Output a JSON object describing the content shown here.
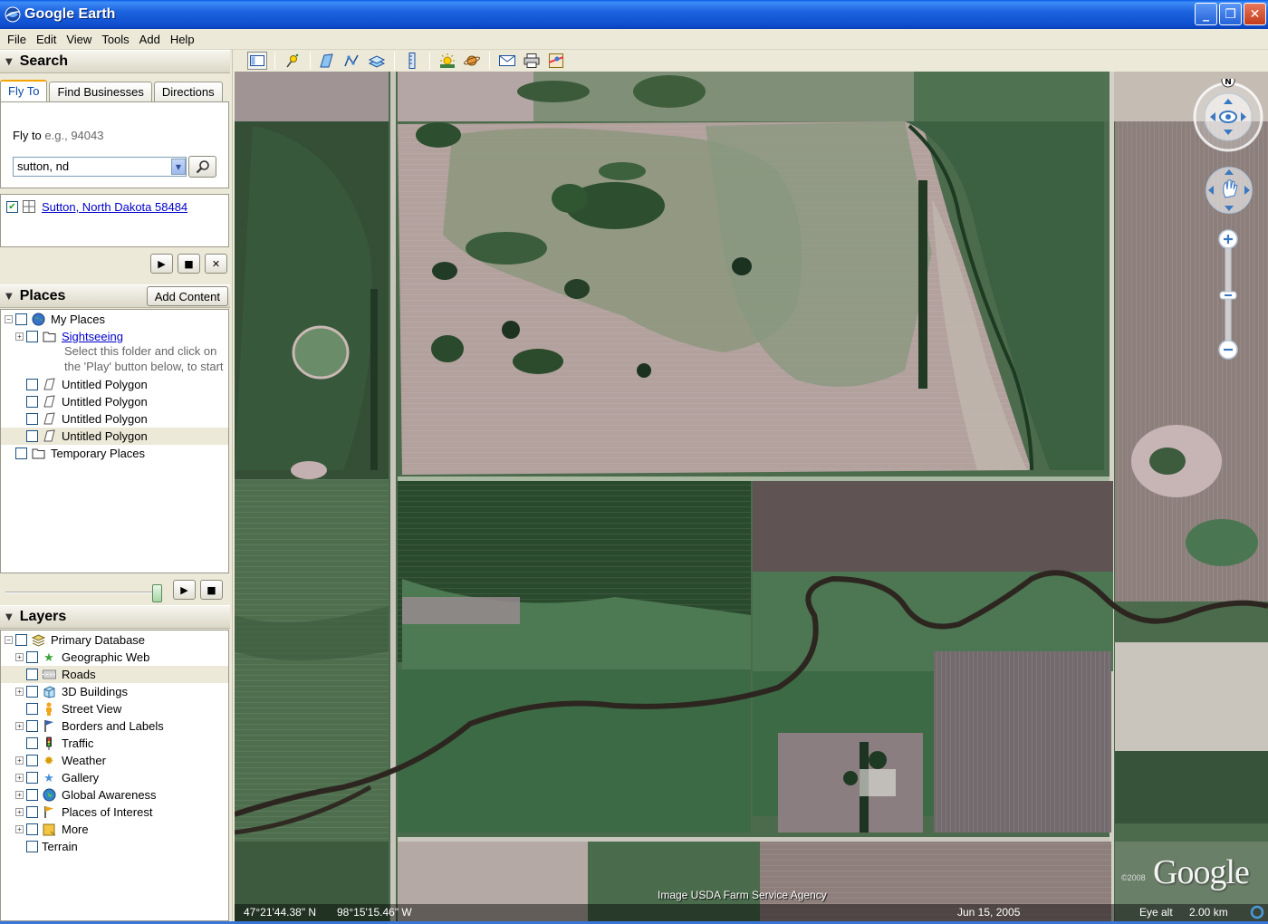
{
  "window": {
    "title": "Google Earth",
    "minimize_label": "_",
    "maximize_label": "❐",
    "close_label": "✕"
  },
  "menu": [
    "File",
    "Edit",
    "View",
    "Tools",
    "Add",
    "Help"
  ],
  "search": {
    "header": "Search",
    "tabs": [
      "Fly To",
      "Find Businesses",
      "Directions"
    ],
    "fly_label": "Fly to",
    "fly_placeholder": "e.g., 94043",
    "input_value": "sutton, nd",
    "result": "Sutton, North Dakota 58484"
  },
  "places": {
    "header": "Places",
    "add_content": "Add Content",
    "items": [
      "My Places",
      "Sightseeing",
      "Untitled Polygon",
      "Untitled Polygon",
      "Untitled Polygon",
      "Untitled Polygon",
      "Temporary Places"
    ],
    "note_line1": "Select this folder and click on",
    "note_line2": "the 'Play' button below, to start"
  },
  "layers": {
    "header": "Layers",
    "items": [
      "Primary Database",
      "Geographic Web",
      "Roads",
      "3D Buildings",
      "Street View",
      "Borders and Labels",
      "Traffic",
      "Weather",
      "Gallery",
      "Global Awareness",
      "Places of Interest",
      "More",
      "Terrain"
    ]
  },
  "map": {
    "attribution": "Image USDA Farm Service Agency",
    "latitude": "47°21'44.38\" N",
    "longitude": "98°15'15.46\" W",
    "date": "Jun 15, 2005",
    "eye_alt_label": "Eye alt",
    "eye_alt_value": "2.00 km",
    "logo": "Google",
    "copyright": "©2008",
    "compass_n": "N"
  },
  "colors": {
    "titlebar": "#0f4fd0",
    "chrome": "#ece9d8",
    "link": "#0000cc",
    "field_pink": "#b3a39c",
    "field_green": "#3f5d3e"
  }
}
